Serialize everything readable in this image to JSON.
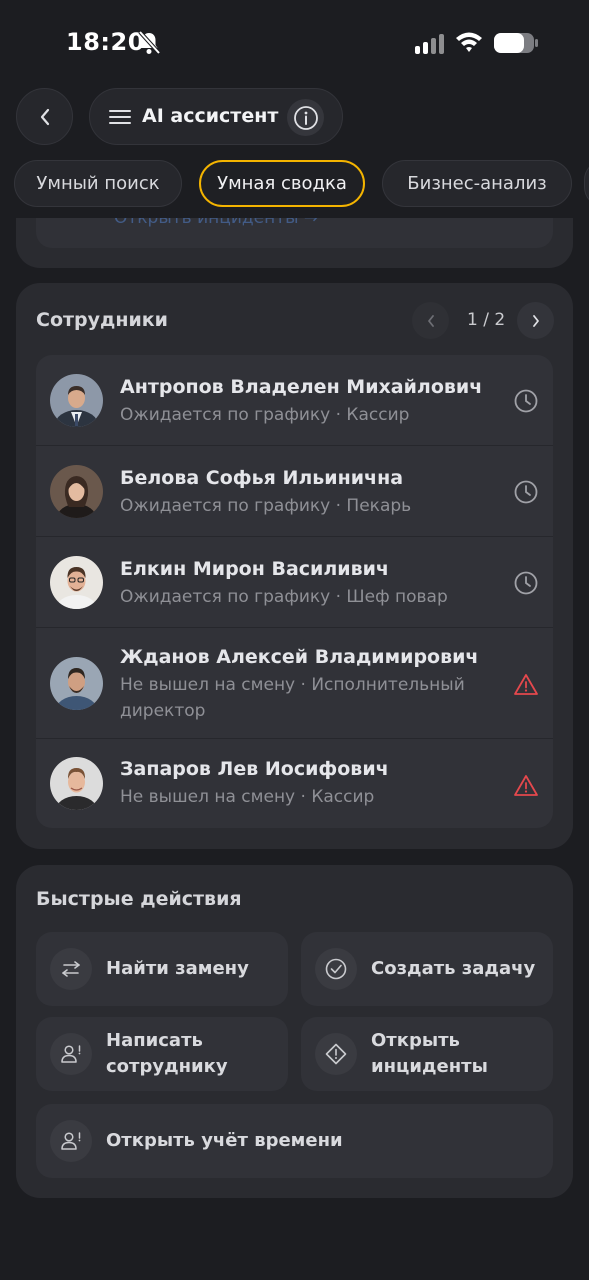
{
  "status_bar": {
    "time": "18:20"
  },
  "header": {
    "title": "AI ассистент"
  },
  "tabs": [
    {
      "label": "Умный поиск",
      "active": false
    },
    {
      "label": "Умная сводка",
      "active": true
    },
    {
      "label": "Бизнес-анализ",
      "active": false
    }
  ],
  "previous_card": {
    "link_text": "Открыть инциденты →"
  },
  "employees": {
    "title": "Сотрудники",
    "pager": "1 / 2",
    "items": [
      {
        "name": "Антропов Владелен Михайлович",
        "status": "Ожидается по графику · Кассир",
        "status_icon": "clock-icon"
      },
      {
        "name": "Белова Софья Ильинична",
        "status": "Ожидается по графику · Пекарь",
        "status_icon": "clock-icon"
      },
      {
        "name": "Елкин Мирон Василивич",
        "status": "Ожидается по графику · Шеф повар",
        "status_icon": "clock-icon"
      },
      {
        "name": "Жданов Алексей Владимирович",
        "status": "Не вышел на смену · Исполнительный директор",
        "status_icon": "warning-icon"
      },
      {
        "name": "Запаров Лев Иосифович",
        "status": "Не вышел на смену · Кассир",
        "status_icon": "warning-icon"
      }
    ]
  },
  "quick_actions": {
    "title": "Быстрые действия",
    "find_replacement": "Найти замену",
    "create_task": "Создать задачу",
    "write_employee_line1": "Написать",
    "write_employee_line2": "сотруднику",
    "open_incidents_line1": "Открыть",
    "open_incidents_line2": "инциденты",
    "open_time_tracking": "Открыть учёт времени"
  },
  "colors": {
    "background": "#1c1d21",
    "card": "#2a2b30",
    "active_tab_border": "#f4b400",
    "warning": "#e5484d"
  }
}
